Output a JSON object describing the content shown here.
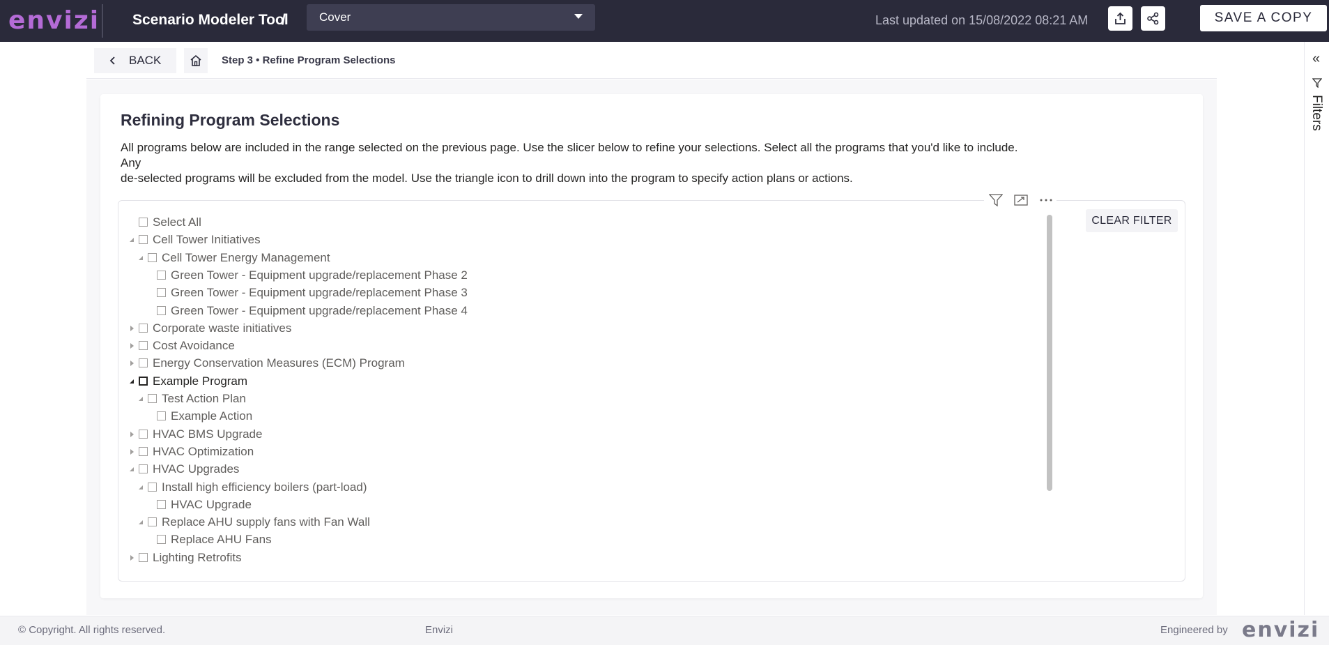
{
  "brand": {
    "logo_text": "envizi",
    "accent": "#b46bd6",
    "topbar_bg": "#2a2a3a"
  },
  "topbar": {
    "app_title": "Scenario Modeler Tool",
    "separator": "/",
    "page_select": {
      "value": "Cover",
      "icon": "chevron-down-icon"
    },
    "last_updated": "Last updated on 15/08/2022 08:21 AM",
    "export_icon": "export-icon",
    "share_icon": "share-icon",
    "save_copy_label": "SAVE A COPY"
  },
  "page_header": {
    "back_label": "BACK",
    "home_icon": "home-icon",
    "breadcrumb": "Step 3 • Refine Program Selections"
  },
  "filters_pane": {
    "label": "Filters",
    "collapse_icon": "double-chevron-left-icon",
    "filter_icon": "filter-icon"
  },
  "card": {
    "title": "Refining Program Selections",
    "description_line1": "All programs below are included in the range selected on the previous page. Use the slicer below to refine your selections. Select all the programs that you'd like to include. Any",
    "description_line2": "de-selected programs will be excluded from the model. Use the triangle icon to drill down into the program to specify action plans or actions."
  },
  "slicer": {
    "header_icons": [
      "filter-icon",
      "focus-mode-icon",
      "more-options-icon"
    ],
    "clear_filter_label": "CLEAR FILTER",
    "items": [
      {
        "label": "Select All",
        "level": 0,
        "expander": "none",
        "checked": false
      },
      {
        "label": "Cell Tower Initiatives",
        "level": 0,
        "expander": "expanded",
        "checked": false
      },
      {
        "label": "Cell Tower Energy Management",
        "level": 1,
        "expander": "expanded",
        "checked": false
      },
      {
        "label": "Green Tower - Equipment upgrade/replacement Phase 2",
        "level": 2,
        "expander": "none",
        "checked": false
      },
      {
        "label": "Green Tower - Equipment upgrade/replacement Phase 3",
        "level": 2,
        "expander": "none",
        "checked": false
      },
      {
        "label": "Green Tower - Equipment upgrade/replacement Phase 4",
        "level": 2,
        "expander": "none",
        "checked": false
      },
      {
        "label": "Corporate waste initiatives",
        "level": 0,
        "expander": "collapsed",
        "checked": false
      },
      {
        "label": "Cost Avoidance",
        "level": 0,
        "expander": "collapsed",
        "checked": false
      },
      {
        "label": "Energy Conservation Measures (ECM) Program",
        "level": 0,
        "expander": "collapsed",
        "checked": false
      },
      {
        "label": "Example Program",
        "level": 0,
        "expander": "expanded",
        "checked": false,
        "active": true
      },
      {
        "label": "Test Action Plan",
        "level": 1,
        "expander": "expanded",
        "checked": false
      },
      {
        "label": "Example Action",
        "level": 2,
        "expander": "none",
        "checked": false
      },
      {
        "label": "HVAC BMS Upgrade",
        "level": 0,
        "expander": "collapsed",
        "checked": false
      },
      {
        "label": "HVAC Optimization",
        "level": 0,
        "expander": "collapsed",
        "checked": false
      },
      {
        "label": "HVAC Upgrades",
        "level": 0,
        "expander": "expanded",
        "checked": false
      },
      {
        "label": "Install high efficiency boilers (part-load)",
        "level": 1,
        "expander": "expanded",
        "checked": false
      },
      {
        "label": "HVAC Upgrade",
        "level": 2,
        "expander": "none",
        "checked": false
      },
      {
        "label": "Replace AHU supply fans with Fan Wall",
        "level": 1,
        "expander": "expanded",
        "checked": false
      },
      {
        "label": "Replace AHU Fans",
        "level": 2,
        "expander": "none",
        "checked": false
      },
      {
        "label": "Lighting Retrofits",
        "level": 0,
        "expander": "collapsed",
        "checked": false
      }
    ]
  },
  "footer": {
    "copyright": "© Copyright. All rights reserved.",
    "center": "Envizi",
    "engineered_by": "Engineered by",
    "logo_text": "envizi"
  }
}
